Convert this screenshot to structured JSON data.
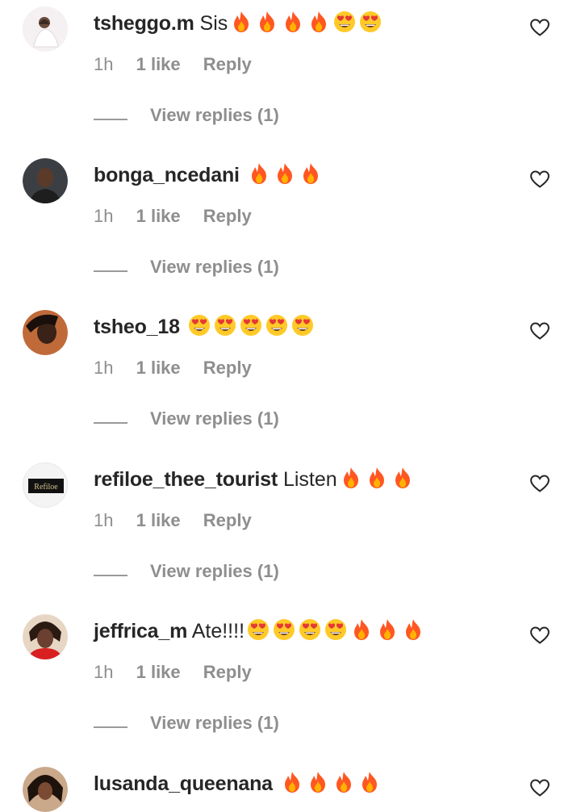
{
  "comments": [
    {
      "username": "tsheggo.m",
      "text": "Sis",
      "emojis": [
        "fire",
        "fire",
        "fire",
        "fire",
        "heart-eyes",
        "heart-eyes"
      ],
      "time": "1h",
      "likes": "1 like",
      "reply": "Reply",
      "view_replies": "View replies (1)"
    },
    {
      "username": "bonga_ncedani",
      "text": "",
      "emojis": [
        "fire",
        "fire",
        "fire"
      ],
      "time": "1h",
      "likes": "1 like",
      "reply": "Reply",
      "view_replies": "View replies (1)"
    },
    {
      "username": "tsheo_18",
      "text": "",
      "emojis": [
        "heart-eyes",
        "heart-eyes",
        "heart-eyes",
        "heart-eyes",
        "heart-eyes"
      ],
      "time": "1h",
      "likes": "1 like",
      "reply": "Reply",
      "view_replies": "View replies (1)"
    },
    {
      "username": "refiloe_thee_tourist",
      "text": "Listen",
      "emojis": [
        "fire",
        "fire",
        "fire"
      ],
      "time": "1h",
      "likes": "1 like",
      "reply": "Reply",
      "view_replies": "View replies (1)"
    },
    {
      "username": "jeffrica_m",
      "text": "Ate!!!!",
      "emojis": [
        "heart-eyes",
        "heart-eyes",
        "heart-eyes",
        "heart-eyes",
        "fire",
        "fire",
        "fire"
      ],
      "time": "1h",
      "likes": "1 like",
      "reply": "Reply",
      "view_replies": "View replies (1)"
    },
    {
      "username": "lusanda_queenana",
      "text": "",
      "emojis": [
        "fire",
        "fire",
        "fire",
        "fire"
      ]
    }
  ],
  "avatars": {
    "logo_text": "Refiloe"
  },
  "colors": {
    "username": "#262626",
    "meta": "#8e8e8e",
    "fire": "#ff5722",
    "emoji_face": "#ffca28",
    "heart_eye": "#e53935"
  }
}
